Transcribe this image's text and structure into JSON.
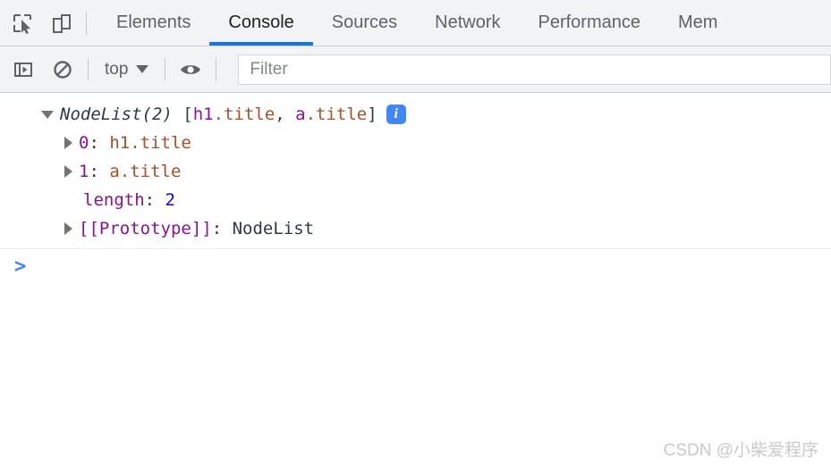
{
  "toolbar": {
    "inspect_icon": "inspect-element-icon",
    "device_icon": "device-toolbar-icon"
  },
  "tabs": [
    {
      "label": "Elements",
      "active": false
    },
    {
      "label": "Console",
      "active": true
    },
    {
      "label": "Sources",
      "active": false
    },
    {
      "label": "Network",
      "active": false
    },
    {
      "label": "Performance",
      "active": false
    },
    {
      "label": "Mem",
      "active": false
    }
  ],
  "filterbar": {
    "sidebar_toggle_icon": "console-sidebar-icon",
    "clear_icon": "clear-console-icon",
    "context_value": "top",
    "eye_icon": "live-expression-eye-icon",
    "filter_placeholder": "Filter"
  },
  "console": {
    "result": {
      "class_name": "NodeList(2)",
      "open_bracket": " [",
      "item0": "h1",
      "item0_suffix": ".title",
      "separator": ", ",
      "item1": "a",
      "item1_suffix": ".title",
      "close_bracket": "]",
      "info_badge": "i"
    },
    "properties": [
      {
        "key": "0",
        "sep": ": ",
        "value": "h1.title",
        "expandable": true,
        "value_kind": "node"
      },
      {
        "key": "1",
        "sep": ": ",
        "value": "a.title",
        "expandable": true,
        "value_kind": "node"
      },
      {
        "key": "length",
        "sep": ": ",
        "value": "2",
        "expandable": false,
        "value_kind": "number"
      },
      {
        "key": "[[Prototype]]",
        "sep": ": ",
        "value": "NodeList",
        "expandable": true,
        "value_kind": "plain"
      }
    ]
  },
  "prompt": {
    "chevron": ">",
    "value": ""
  },
  "watermark": {
    "text": "CSDN @小柴爱程序"
  },
  "colors": {
    "accent_blue": "#1a73e8",
    "toolbar_bg": "#f1f3f4",
    "property_name": "#881391",
    "node_name": "#a0522d",
    "number": "#1c00cf",
    "info_badge": "#4285f4"
  }
}
